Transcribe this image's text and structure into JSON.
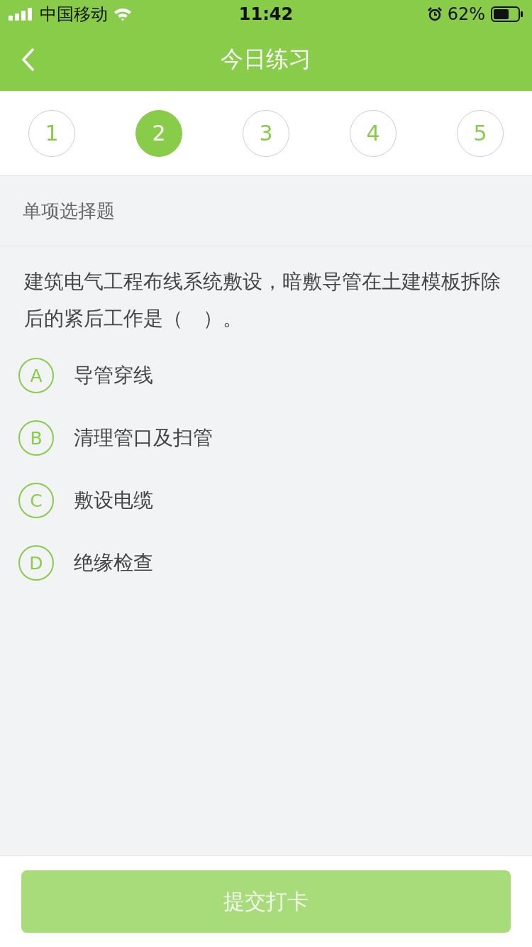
{
  "status_bar": {
    "carrier": "中国移动",
    "time": "11:42",
    "battery": "62%"
  },
  "nav": {
    "title": "今日练习"
  },
  "steps": [
    {
      "label": "1",
      "selected": false
    },
    {
      "label": "2",
      "selected": true
    },
    {
      "label": "3",
      "selected": false
    },
    {
      "label": "4",
      "selected": false
    },
    {
      "label": "5",
      "selected": false
    }
  ],
  "section": {
    "title": "单项选择题"
  },
  "question": {
    "text": "建筑电气工程布线系统敷设，暗敷导管在土建模板拆除后的紧后工作是（　）。"
  },
  "options": [
    {
      "letter": "A",
      "text": "导管穿线",
      "selected": false
    },
    {
      "letter": "B",
      "text": "清理管口及扫管",
      "selected": false
    },
    {
      "letter": "C",
      "text": "敷设电缆",
      "selected": false
    },
    {
      "letter": "D",
      "text": "绝缘检查",
      "selected": false
    }
  ],
  "submit": {
    "label": "提交打卡",
    "disabled": true
  }
}
